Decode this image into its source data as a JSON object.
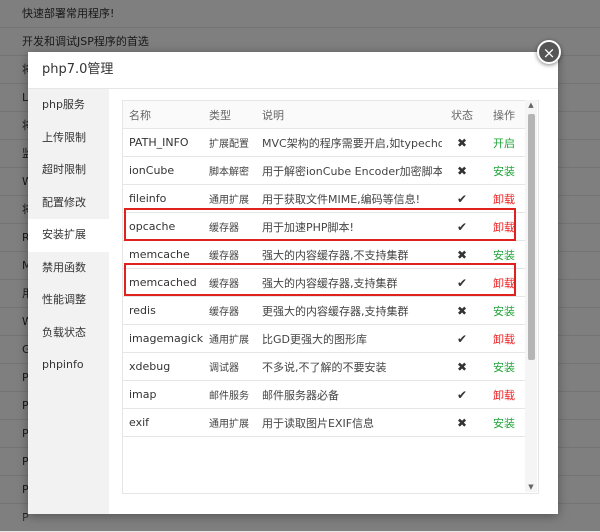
{
  "background_rows": [
    "快速部署常用程序!",
    "开发和调试JSP程序的首选",
    "将",
    "L",
    "将",
    "监",
    "W",
    "将",
    "R",
    "M",
    "用",
    "W",
    "G",
    "P",
    "P",
    "P",
    "P",
    "P",
    "P"
  ],
  "modal": {
    "title": "php7.0管理",
    "close_symbol": "×"
  },
  "nav": [
    {
      "label": "php服务",
      "active": false
    },
    {
      "label": "上传限制",
      "active": false
    },
    {
      "label": "超时限制",
      "active": false
    },
    {
      "label": "配置修改",
      "active": false
    },
    {
      "label": "安装扩展",
      "active": true
    },
    {
      "label": "禁用函数",
      "active": false
    },
    {
      "label": "性能调整",
      "active": false
    },
    {
      "label": "负载状态",
      "active": false
    },
    {
      "label": "phpinfo",
      "active": false
    }
  ],
  "table": {
    "headers": {
      "name": "名称",
      "type": "类型",
      "desc": "说明",
      "status": "状态",
      "op": "操作"
    },
    "rows": [
      {
        "name": "PATH_INFO",
        "type": "扩展配置",
        "desc": "MVC架构的程序需要开启,如typecho",
        "status": "cross",
        "op": "开启",
        "op_color": "green"
      },
      {
        "name": "ionCube",
        "type": "脚本解密",
        "desc": "用于解密ionCube Encoder加密脚本!",
        "status": "cross",
        "op": "安装",
        "op_color": "green"
      },
      {
        "name": "fileinfo",
        "type": "通用扩展",
        "desc": "用于获取文件MIME,编码等信息!",
        "status": "check",
        "op": "卸载",
        "op_color": "red"
      },
      {
        "name": "opcache",
        "type": "缓存器",
        "desc": "用于加速PHP脚本!",
        "status": "check",
        "op": "卸载",
        "op_color": "red"
      },
      {
        "name": "memcache",
        "type": "缓存器",
        "desc": "强大的内容缓存器,不支持集群",
        "status": "cross",
        "op": "安装",
        "op_color": "green"
      },
      {
        "name": "memcached",
        "type": "缓存器",
        "desc": "强大的内容缓存器,支持集群",
        "status": "check",
        "op": "卸载",
        "op_color": "red"
      },
      {
        "name": "redis",
        "type": "缓存器",
        "desc": "更强大的内容缓存器,支持集群",
        "status": "cross",
        "op": "安装",
        "op_color": "green"
      },
      {
        "name": "imagemagick",
        "type": "通用扩展",
        "desc": "比GD更强大的图形库",
        "status": "check",
        "op": "卸载",
        "op_color": "red"
      },
      {
        "name": "xdebug",
        "type": "调试器",
        "desc": "不多说,不了解的不要安装",
        "status": "cross",
        "op": "安装",
        "op_color": "green"
      },
      {
        "name": "imap",
        "type": "邮件服务",
        "desc": "邮件服务器必备",
        "status": "check",
        "op": "卸载",
        "op_color": "red"
      },
      {
        "name": "exif",
        "type": "通用扩展",
        "desc": "用于读取图片EXIF信息",
        "status": "cross",
        "op": "安装",
        "op_color": "green"
      }
    ]
  },
  "icons": {
    "check": "✔",
    "cross": "✖"
  },
  "colors": {
    "install": "#20a53a",
    "uninstall": "#e22222",
    "highlight": "#e0221f"
  }
}
